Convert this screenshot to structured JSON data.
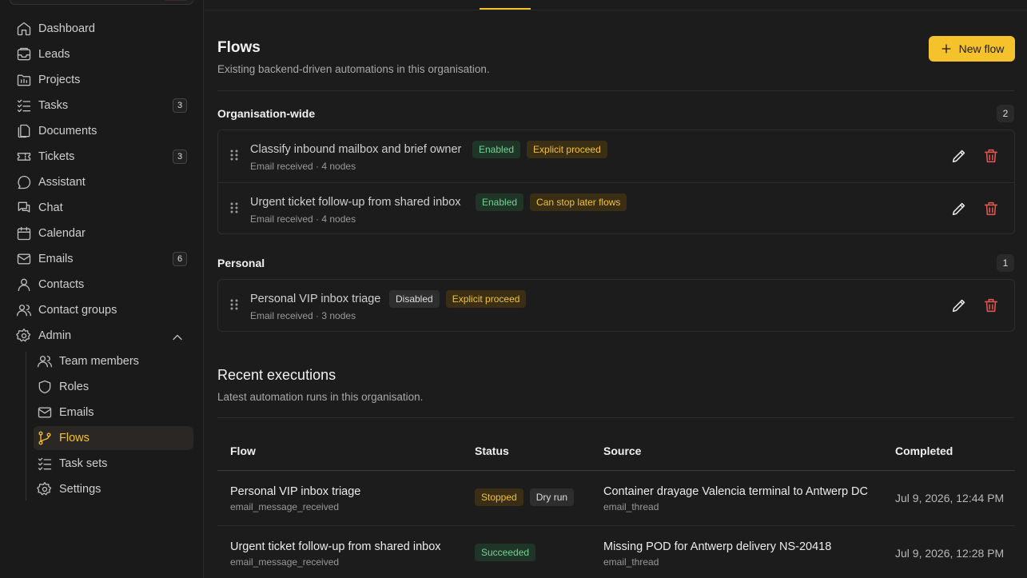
{
  "sidebar": {
    "items": [
      {
        "label": "Dashboard",
        "icon": "home-icon"
      },
      {
        "label": "Leads",
        "icon": "inbox-icon"
      },
      {
        "label": "Projects",
        "icon": "folder-icon"
      },
      {
        "label": "Tasks",
        "icon": "list-check-icon",
        "badge": "3"
      },
      {
        "label": "Documents",
        "icon": "documents-icon"
      },
      {
        "label": "Tickets",
        "icon": "ticket-icon",
        "badge": "3"
      },
      {
        "label": "Assistant",
        "icon": "chat-bubble-icon"
      },
      {
        "label": "Chat",
        "icon": "messages-icon"
      },
      {
        "label": "Calendar",
        "icon": "calendar-icon"
      },
      {
        "label": "Emails",
        "icon": "mail-icon",
        "badge": "6"
      },
      {
        "label": "Contacts",
        "icon": "user-icon"
      },
      {
        "label": "Contact groups",
        "icon": "users-icon"
      },
      {
        "label": "Admin",
        "icon": "gear-icon"
      }
    ],
    "admin_sub": [
      {
        "label": "Team members",
        "icon": "users-icon"
      },
      {
        "label": "Roles",
        "icon": "shield-icon"
      },
      {
        "label": "Emails",
        "icon": "mail-icon"
      },
      {
        "label": "Flows",
        "icon": "git-branch-icon",
        "active": true
      },
      {
        "label": "Task sets",
        "icon": "list-check-icon"
      },
      {
        "label": "Settings",
        "icon": "gear-icon"
      }
    ]
  },
  "flows": {
    "title": "Flows",
    "subtitle": "Existing backend-driven automations in this organisation.",
    "new_button": "New flow",
    "groups": [
      {
        "label": "Organisation-wide",
        "count": "2",
        "rows": [
          {
            "name": "Classify inbound mailbox and brief owner",
            "meta": "Email received · 4 nodes",
            "badges": [
              {
                "text": "Enabled",
                "kind": "green"
              },
              {
                "text": "Explicit proceed",
                "kind": "amber"
              }
            ]
          },
          {
            "name": "Urgent ticket follow-up from shared inbox",
            "meta": "Email received · 4 nodes",
            "badges": [
              {
                "text": "Enabled",
                "kind": "green"
              },
              {
                "text": "Can stop later flows",
                "kind": "amber"
              }
            ]
          }
        ]
      },
      {
        "label": "Personal",
        "count": "1",
        "rows": [
          {
            "name": "Personal VIP inbox triage",
            "meta": "Email received · 3 nodes",
            "badges": [
              {
                "text": "Disabled",
                "kind": "grey"
              },
              {
                "text": "Explicit proceed",
                "kind": "amber"
              }
            ]
          }
        ]
      }
    ]
  },
  "executions": {
    "title": "Recent executions",
    "subtitle": "Latest automation runs in this organisation.",
    "columns": [
      "Flow",
      "Status",
      "Source",
      "Completed"
    ],
    "rows": [
      {
        "flow": "Personal VIP inbox triage",
        "flow_sub": "email_message_received",
        "badges": [
          {
            "text": "Stopped",
            "kind": "amber"
          },
          {
            "text": "Dry run",
            "kind": "grey"
          }
        ],
        "source": "Container drayage Valencia terminal to Antwerp DC",
        "source_sub": "email_thread",
        "completed": "Jul 9, 2026, 12:44 PM"
      },
      {
        "flow": "Urgent ticket follow-up from shared inbox",
        "flow_sub": "email_message_received",
        "badges": [
          {
            "text": "Succeeded",
            "kind": "green"
          }
        ],
        "source": "Missing POD for Antwerp delivery NS-20418",
        "source_sub": "email_thread",
        "completed": "Jul 9, 2026, 12:28 PM"
      }
    ]
  }
}
